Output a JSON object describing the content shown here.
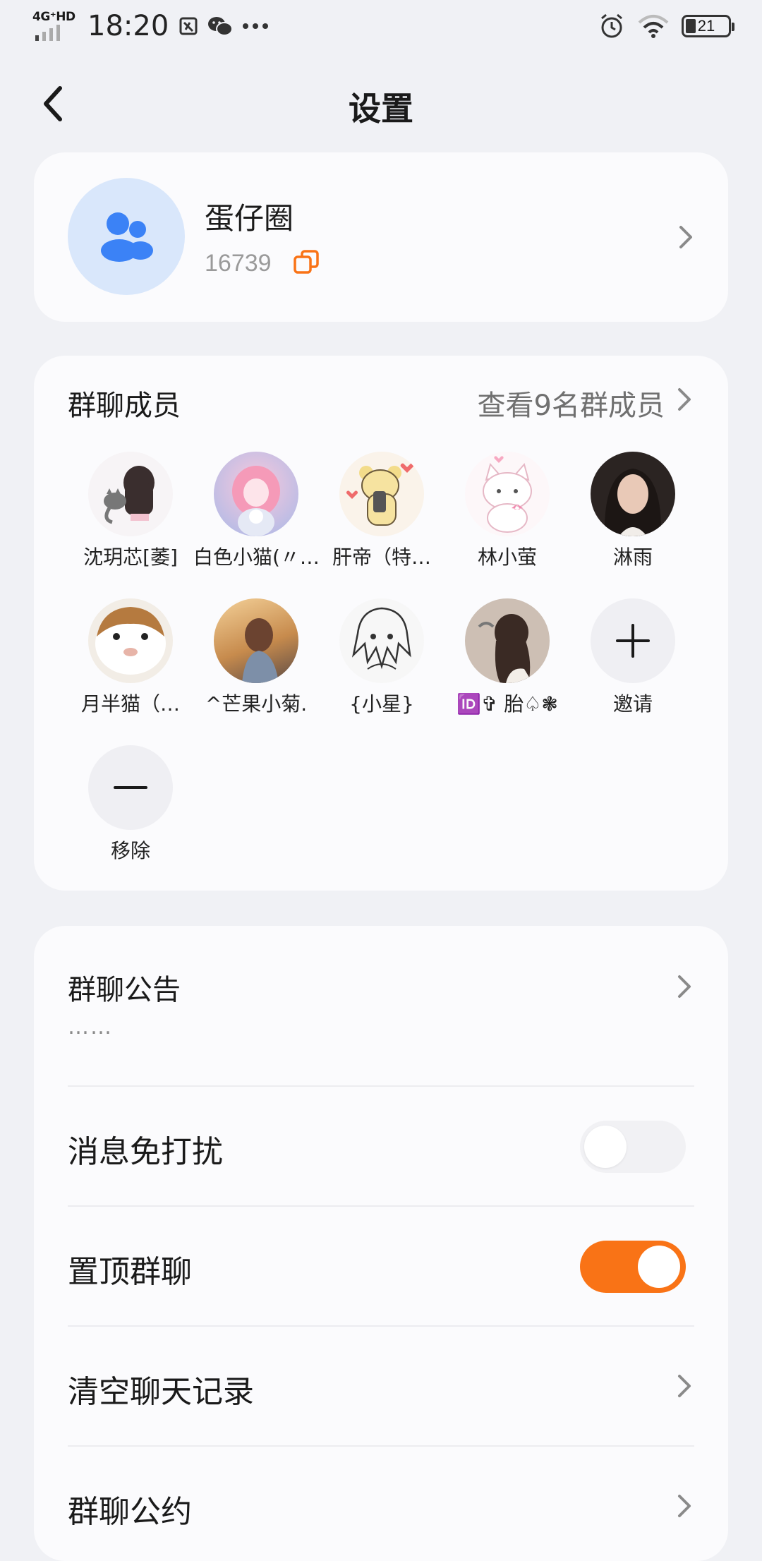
{
  "status_bar": {
    "network": "4G⁺HD",
    "time": "18:20",
    "battery": "21"
  },
  "header": {
    "title": "设置"
  },
  "group": {
    "name": "蛋仔圈",
    "id": "16739"
  },
  "members": {
    "title": "群聊成员",
    "view_all": "查看9名群成员",
    "list": [
      {
        "name": "沈玥芯[萎]"
      },
      {
        "name": "白色小猫(〃…"
      },
      {
        "name": "肝帝（特…"
      },
      {
        "name": "林小萤"
      },
      {
        "name": "淋雨"
      },
      {
        "name": "月半猫（…"
      },
      {
        "name": "^芒果小菊."
      },
      {
        "name": "{小星}"
      },
      {
        "name": "🆔✞ 胎♤❃"
      }
    ],
    "invite_label": "邀请",
    "remove_label": "移除"
  },
  "settings": {
    "announcement_label": "群聊公告",
    "announcement_preview": "……",
    "dnd_label": "消息免打扰",
    "dnd_on": false,
    "pin_label": "置顶群聊",
    "pin_on": true,
    "clear_label": "清空聊天记录",
    "rules_label": "群聊公约"
  },
  "colors": {
    "accent": "#f97316",
    "group_avatar_bg": "#d9e7fb",
    "group_icon": "#3b82f6"
  }
}
